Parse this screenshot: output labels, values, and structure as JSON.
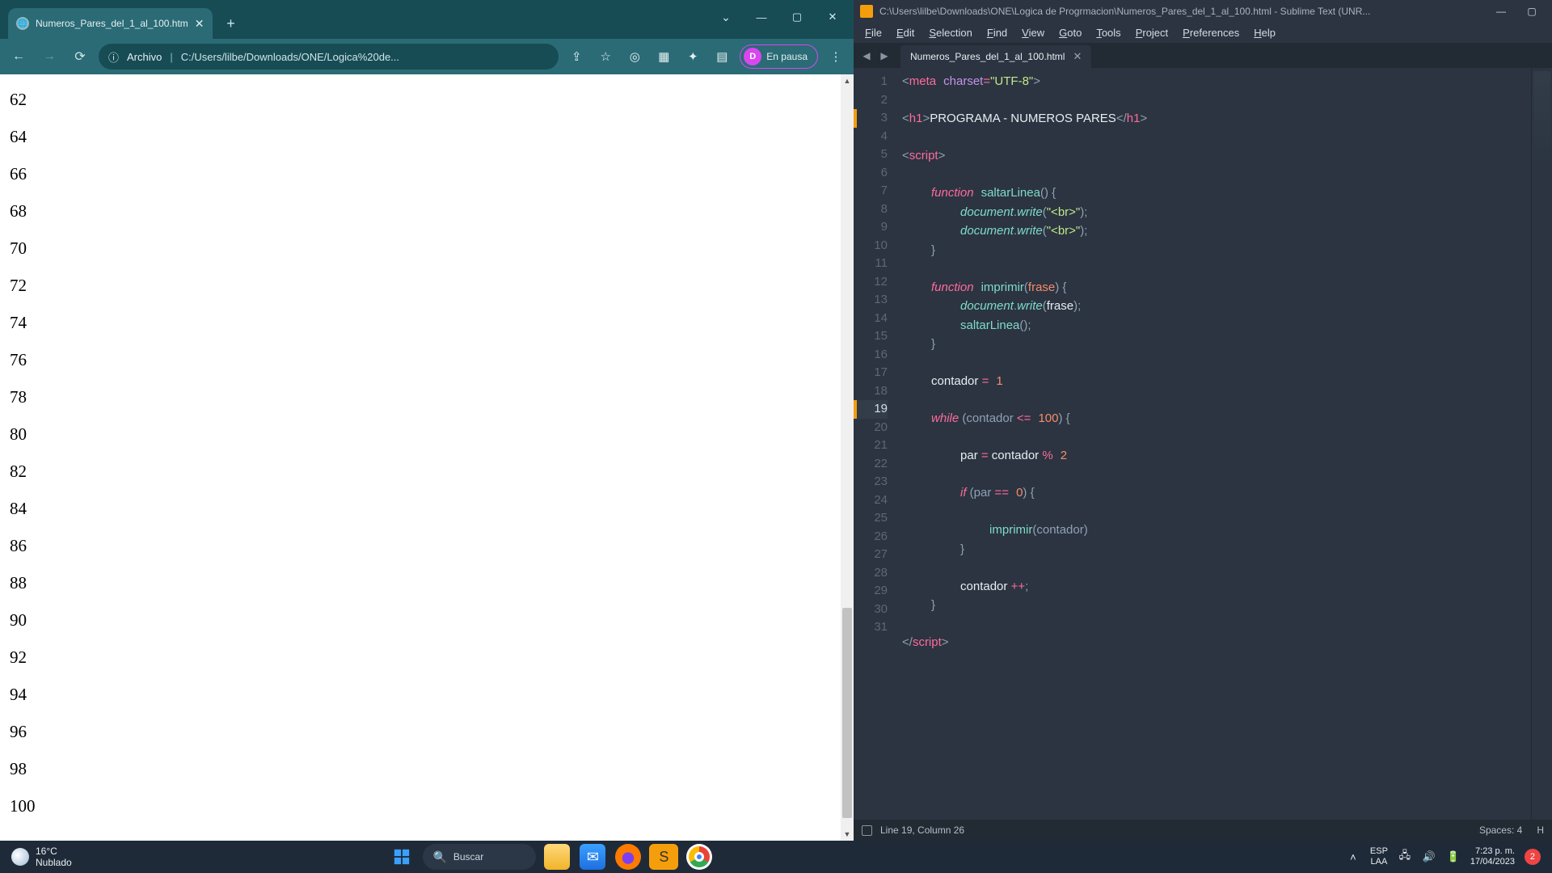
{
  "chrome": {
    "tab_title": "Numeros_Pares_del_1_al_100.htm",
    "address_label": "Archivo",
    "url": "C:/Users/lilbe/Downloads/ONE/Logica%20de...",
    "profile_initial": "D",
    "profile_text": "En pausa",
    "even_numbers": [
      "62",
      "64",
      "66",
      "68",
      "70",
      "72",
      "74",
      "76",
      "78",
      "80",
      "82",
      "84",
      "86",
      "88",
      "90",
      "92",
      "94",
      "96",
      "98",
      "100"
    ]
  },
  "sublime": {
    "title": "C:\\Users\\lilbe\\Downloads\\ONE\\Logica de Progrmacion\\Numeros_Pares_del_1_al_100.html - Sublime Text (UNR...",
    "menu": [
      "File",
      "Edit",
      "Selection",
      "Find",
      "View",
      "Goto",
      "Tools",
      "Project",
      "Preferences",
      "Help"
    ],
    "tab_name": "Numeros_Pares_del_1_al_100.html",
    "line_count": 31,
    "active_line": 19,
    "modified_lines": [
      3,
      19
    ],
    "status_left": "Line 19, Column 26",
    "status_spaces": "Spaces: 4",
    "status_lang": "H",
    "code": {
      "l1": {
        "a": "<",
        "b": "meta",
        "c": " ",
        "d": "charset",
        "e": "=",
        "f": "\"UTF-8\"",
        "g": ">"
      },
      "l3": {
        "a": "<",
        "b": "h1",
        "c": ">",
        "d": "PROGRAMA - NUMEROS PARES",
        "e": "</",
        "f": "h1",
        "g": ">"
      },
      "l5": {
        "a": "<",
        "b": "script",
        "c": ">"
      },
      "l7": {
        "a": "function",
        "b": " ",
        "c": "saltarLinea",
        "d": "() {"
      },
      "l8": {
        "a": "document",
        "b": ".",
        "c": "write",
        "d": "(",
        "e": "\"<br>\"",
        "f": ");"
      },
      "l9": {
        "a": "document",
        "b": ".",
        "c": "write",
        "d": "(",
        "e": "\"<br>\"",
        "f": ");"
      },
      "l10": {
        "a": "}"
      },
      "l12": {
        "a": "function",
        "b": " ",
        "c": "imprimir",
        "d": "(",
        "e": "frase",
        "f": ") {"
      },
      "l13": {
        "a": "document",
        "b": ".",
        "c": "write",
        "d": "(",
        "e": "frase",
        "f": ");"
      },
      "l14": {
        "a": "saltarLinea",
        "b": "();"
      },
      "l15": {
        "a": "}"
      },
      "l17": {
        "a": "contador ",
        "b": "=",
        "c": " ",
        "d": "1"
      },
      "l19": {
        "a": "while",
        "b": " (contador ",
        "c": "<=",
        "d": " ",
        "e": "100",
        "f": ") {"
      },
      "l21": {
        "a": "par ",
        "b": "=",
        "c": " contador ",
        "d": "%",
        "e": " ",
        "f": "2"
      },
      "l23": {
        "a": "if",
        "b": " (par ",
        "c": "==",
        "d": " ",
        "e": "0",
        "f": ") {"
      },
      "l25": {
        "a": "imprimir",
        "b": "(contador)"
      },
      "l26": {
        "a": "}"
      },
      "l28": {
        "a": "contador ",
        "b": "++",
        "c": ";"
      },
      "l29": {
        "a": "}"
      },
      "l31": {
        "a": "</",
        "b": "script",
        "c": ">"
      }
    }
  },
  "taskbar": {
    "temp": "16°C",
    "weather": "Nublado",
    "search": "Buscar",
    "lang_top": "ESP",
    "lang_bot": "LAA",
    "time": "7:23 p. m.",
    "date": "17/04/2023",
    "notif_count": "2"
  }
}
